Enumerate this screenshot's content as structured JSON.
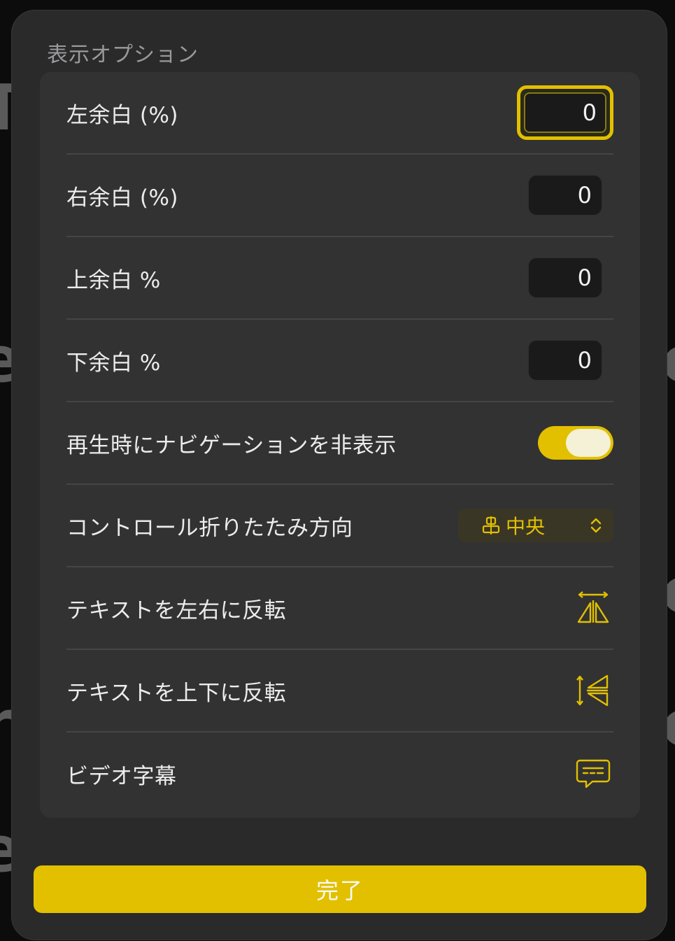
{
  "panel": {
    "title": "表示オプション",
    "done_label": "完了"
  },
  "rows": [
    {
      "label": "左余白 (%)",
      "value": "0"
    },
    {
      "label": "右余白 (%)",
      "value": "0"
    },
    {
      "label": "上余白 %",
      "value": "0"
    },
    {
      "label": "下余白 %",
      "value": "0"
    },
    {
      "label": "再生時にナビゲーションを非表示",
      "toggle_on": true
    },
    {
      "label": "コントロール折りたたみ方向",
      "select_value": "中央"
    },
    {
      "label": "テキストを左右に反転",
      "icon": "flip-horizontal-icon"
    },
    {
      "label": "テキストを上下に反転",
      "icon": "flip-vertical-icon"
    },
    {
      "label": "ビデオ字幕",
      "icon": "subtitles-icon"
    }
  ],
  "colors": {
    "accent": "#e2c000",
    "panel_bg": "#2a2a2b",
    "card_bg": "#323233"
  }
}
